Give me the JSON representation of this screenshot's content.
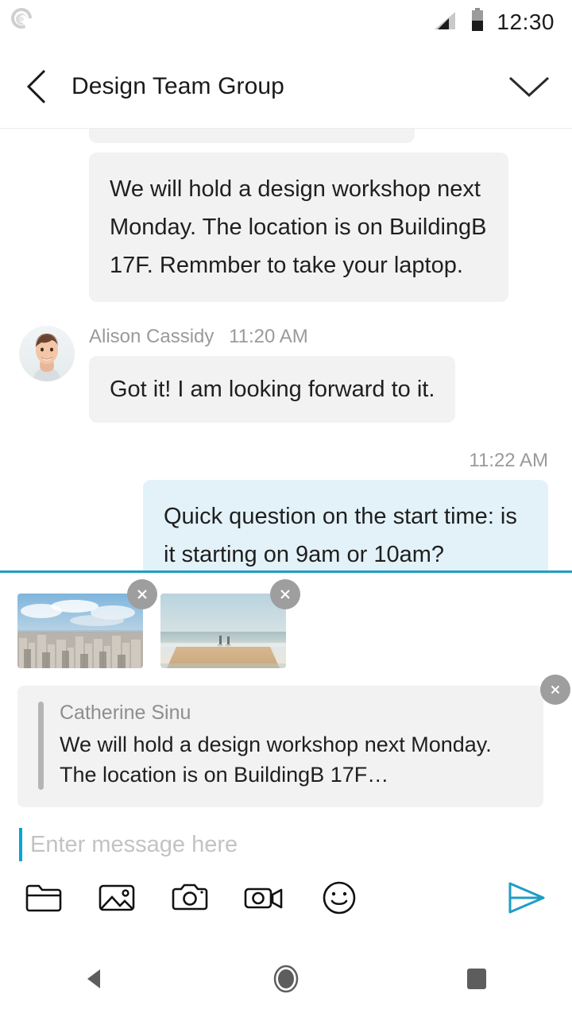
{
  "status_bar": {
    "notification_icon": "swirl-logo-icon",
    "signal_icon": "signal-bars-icon",
    "battery_icon": "battery-half-icon",
    "clock": "12:30"
  },
  "header": {
    "back_icon": "chevron-left-icon",
    "title": "Design Team Group",
    "expand_icon": "chevron-down-icon"
  },
  "conversation": {
    "messages": [
      {
        "id": "partial",
        "type": "partial-bubble",
        "direction": "incoming",
        "text": ""
      },
      {
        "id": "msg-workshop",
        "type": "text",
        "direction": "incoming",
        "text": "We will hold a design workshop next Monday. The location is on BuildingB 17F. Remmber to take your laptop."
      },
      {
        "id": "msg-gotit",
        "type": "text",
        "direction": "incoming",
        "sender": "Alison Cassidy",
        "time": "11:20 AM",
        "avatar": "alison-avatar",
        "text": "Got it! I am looking forward to it."
      },
      {
        "id": "msg-question",
        "type": "text",
        "direction": "outgoing",
        "time": "11:22 AM",
        "text": "Quick question on the start time: is it starting on 9am or 10am?"
      }
    ]
  },
  "composer": {
    "attachments": [
      {
        "name": "cityscape-thumbnail",
        "remove_label": "×"
      },
      {
        "name": "beach-thumbnail",
        "remove_label": "×"
      }
    ],
    "quote": {
      "author": "Catherine Sinu",
      "text": "We will hold a design workshop next Monday. The location is on BuildingB 17F…",
      "remove_label": "×"
    },
    "input": {
      "value": "",
      "placeholder": "Enter message here"
    },
    "tools": [
      {
        "name": "file-folder-icon",
        "label": "Files"
      },
      {
        "name": "image-gallery-icon",
        "label": "Gallery"
      },
      {
        "name": "camera-icon",
        "label": "Camera"
      },
      {
        "name": "video-camera-icon",
        "label": "Video"
      },
      {
        "name": "emoji-smiley-icon",
        "label": "Emoji"
      }
    ],
    "send": {
      "name": "send-paper-plane-icon",
      "label": "Send"
    }
  },
  "nav_bar": {
    "back": "android-back-icon",
    "home": "android-home-icon",
    "recents": "android-recents-icon"
  },
  "colors": {
    "accent": "#1e9ec4",
    "send": "#1e9ec4",
    "caret": "#00a6d6",
    "incoming_bubble": "#f2f2f2",
    "outgoing_bubble": "#e3f2f9",
    "text": "#1f1f1f",
    "muted": "#9a9a9a"
  }
}
